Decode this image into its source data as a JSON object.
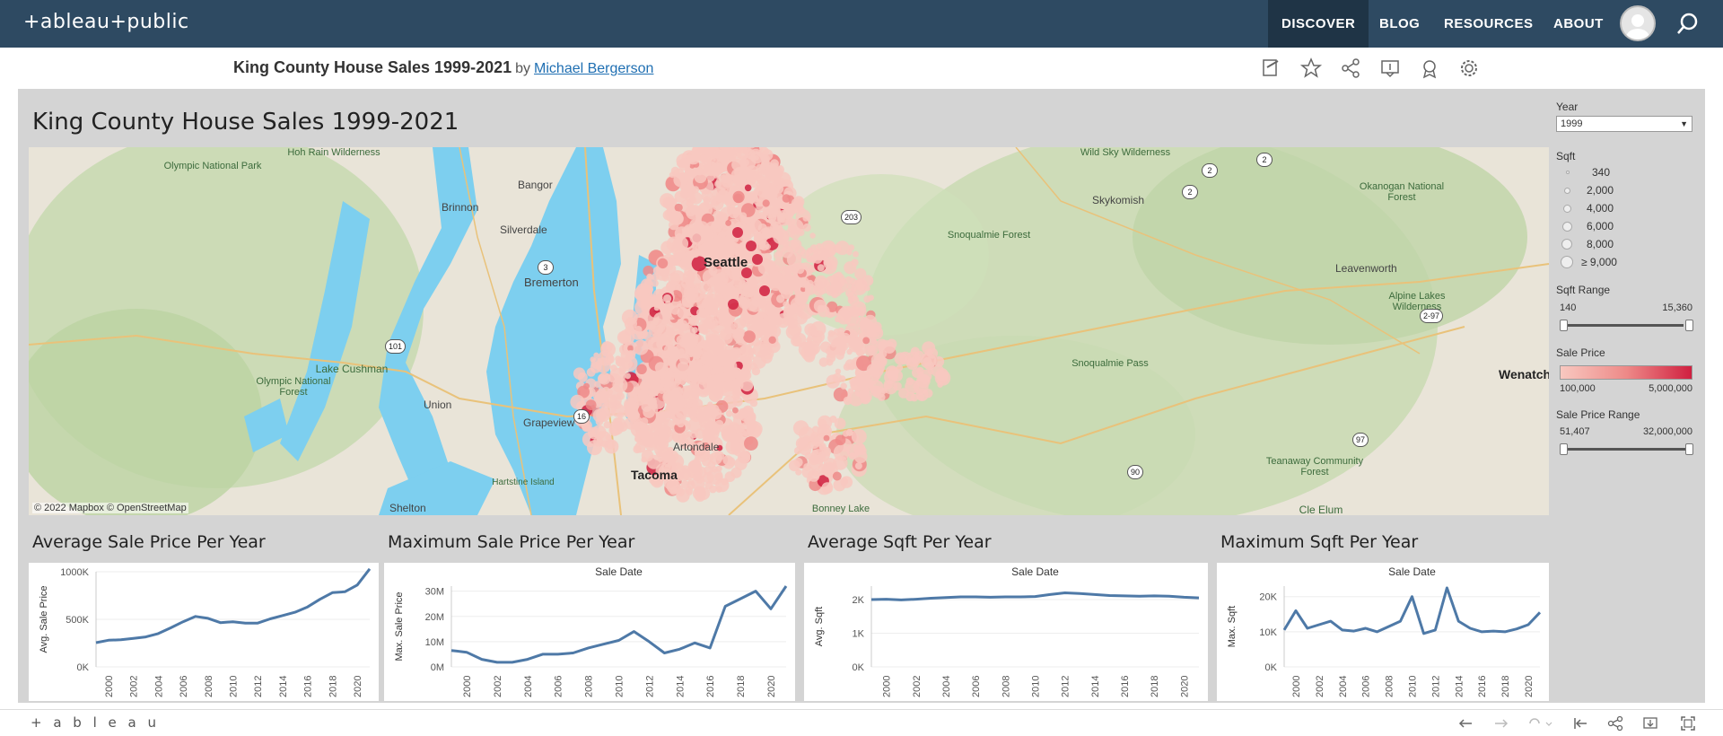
{
  "brand": {
    "logo_text": "+ableau+public",
    "accent": "#2e4a62"
  },
  "nav": {
    "items": [
      "DISCOVER",
      "BLOG",
      "RESOURCES",
      "ABOUT"
    ],
    "active": "DISCOVER"
  },
  "viz_header": {
    "title": "King County House Sales 1999-2021",
    "by": "by",
    "author": "Michael Bergerson"
  },
  "toolbar_icons": [
    "edit-icon",
    "star-icon",
    "share-icon",
    "comment-icon",
    "badge-icon",
    "gear-icon"
  ],
  "dashboard": {
    "title": "King County House Sales 1999-2021",
    "map": {
      "credit": "© 2022 Mapbox  © OpenStreetMap",
      "places": [
        "Olympic National Park",
        "Hoh Rain Wilderness",
        "Brinnon",
        "Bangor",
        "Silverdale",
        "Seattle",
        "Bremerton",
        "Lake Cushman",
        "Olympic National Forest",
        "Union",
        "Grapeview",
        "Artondale",
        "Tacoma",
        "Hartstine Island",
        "Shelton",
        "Bonney Lake",
        "Wild Sky Wilderness",
        "Skykomish",
        "Snoqualmie Forest",
        "Alpine Lakes Wilderness",
        "Snoqualmie Pass",
        "Leavenworth",
        "Okanogan National Forest",
        "Wenatchee",
        "Teanaway Community Forest",
        "Cle Elum"
      ],
      "shields": [
        "3",
        "101",
        "16",
        "2",
        "2",
        "2",
        "203",
        "90",
        "2-97",
        "97"
      ]
    },
    "filters": {
      "year_label": "Year",
      "year_value": "1999",
      "sqft_label": "Sqft",
      "sqft_legend": [
        "340",
        "2,000",
        "4,000",
        "6,000",
        "8,000",
        "≥ 9,000"
      ],
      "sqft_range_label": "Sqft Range",
      "sqft_range": [
        "140",
        "15,360"
      ],
      "price_label": "Sale Price",
      "price_legend": [
        "100,000",
        "5,000,000"
      ],
      "price_range_label": "Sale Price Range",
      "price_range": [
        "51,407",
        "32,000,000"
      ],
      "price_colors": [
        "#f8c8c0",
        "#ee8a88",
        "#d02040"
      ]
    }
  },
  "panels": [
    {
      "title": "Average Sale Price Per Year",
      "header": "",
      "ylabel": "Avg. Sale Price"
    },
    {
      "title": "Maximum Sale Price Per Year",
      "header": "Sale Date",
      "ylabel": "Max. Sale Price"
    },
    {
      "title": "Average Sqft Per Year",
      "header": "Sale Date",
      "ylabel": "Avg. Sqft"
    },
    {
      "title": "Maximum Sqft Per Year",
      "header": "Sale Date",
      "ylabel": "Max. Sqft"
    }
  ],
  "footer": {
    "logo_text": "+ a b l e a u"
  },
  "chart_data": [
    {
      "type": "line",
      "title": "Average Sale Price Per Year",
      "xlabel": "",
      "ylabel": "Avg. Sale Price",
      "x": [
        1999,
        2000,
        2001,
        2002,
        2003,
        2004,
        2005,
        2006,
        2007,
        2008,
        2009,
        2010,
        2011,
        2012,
        2013,
        2014,
        2015,
        2016,
        2017,
        2018,
        2019,
        2020,
        2021
      ],
      "xticks": [
        "2000",
        "2002",
        "2004",
        "2006",
        "2008",
        "2010",
        "2012",
        "2014",
        "2016",
        "2018",
        "2020"
      ],
      "yticks": [
        "0K",
        "500K",
        "1000K"
      ],
      "yticks_values": [
        0,
        500000,
        1000000
      ],
      "ylim": [
        0,
        1000000
      ],
      "series": [
        {
          "values": [
            255000,
            280000,
            285000,
            300000,
            315000,
            350000,
            410000,
            475000,
            530000,
            510000,
            465000,
            475000,
            460000,
            460000,
            505000,
            540000,
            575000,
            630000,
            710000,
            780000,
            790000,
            860000,
            1030000
          ]
        }
      ],
      "color": "#4e79a7"
    },
    {
      "type": "line",
      "title": "Maximum Sale Price Per Year",
      "xlabel": "Sale Date",
      "ylabel": "Max. Sale Price",
      "x": [
        1999,
        2000,
        2001,
        2002,
        2003,
        2004,
        2005,
        2006,
        2007,
        2008,
        2009,
        2010,
        2011,
        2012,
        2013,
        2014,
        2015,
        2016,
        2017,
        2018,
        2019,
        2020,
        2021
      ],
      "xticks": [
        "2000",
        "2002",
        "2004",
        "2006",
        "2008",
        "2010",
        "2012",
        "2014",
        "2016",
        "2018",
        "2020"
      ],
      "yticks": [
        "0M",
        "10M",
        "20M",
        "30M"
      ],
      "yticks_values": [
        0,
        10000000,
        20000000,
        30000000
      ],
      "ylim": [
        0,
        32000000
      ],
      "series": [
        {
          "values": [
            6500000,
            5800000,
            3000000,
            1800000,
            1800000,
            3000000,
            5000000,
            5000000,
            5500000,
            7500000,
            9000000,
            10500000,
            14000000,
            10000000,
            5500000,
            7000000,
            9500000,
            7500000,
            24000000,
            27000000,
            30000000,
            23000000,
            32000000
          ]
        }
      ],
      "color": "#4e79a7"
    },
    {
      "type": "line",
      "title": "Average Sqft Per Year",
      "xlabel": "Sale Date",
      "ylabel": "Avg. Sqft",
      "x": [
        1999,
        2000,
        2001,
        2002,
        2003,
        2004,
        2005,
        2006,
        2007,
        2008,
        2009,
        2010,
        2011,
        2012,
        2013,
        2014,
        2015,
        2016,
        2017,
        2018,
        2019,
        2020,
        2021
      ],
      "xticks": [
        "2000",
        "2002",
        "2004",
        "2006",
        "2008",
        "2010",
        "2012",
        "2014",
        "2016",
        "2018",
        "2020"
      ],
      "yticks": [
        "0K",
        "1K",
        "2K"
      ],
      "yticks_values": [
        0,
        1000,
        2000
      ],
      "ylim": [
        0,
        2400
      ],
      "series": [
        {
          "values": [
            2000,
            2010,
            1990,
            2010,
            2040,
            2060,
            2080,
            2080,
            2070,
            2080,
            2080,
            2090,
            2150,
            2200,
            2180,
            2150,
            2120,
            2110,
            2100,
            2110,
            2100,
            2070,
            2050
          ]
        }
      ],
      "color": "#4e79a7"
    },
    {
      "type": "line",
      "title": "Maximum Sqft Per Year",
      "xlabel": "Sale Date",
      "ylabel": "Max. Sqft",
      "x": [
        1999,
        2000,
        2001,
        2002,
        2003,
        2004,
        2005,
        2006,
        2007,
        2008,
        2009,
        2010,
        2011,
        2012,
        2013,
        2014,
        2015,
        2016,
        2017,
        2018,
        2019,
        2020,
        2021
      ],
      "xticks": [
        "2000",
        "2002",
        "2004",
        "2006",
        "2008",
        "2010",
        "2012",
        "2014",
        "2016",
        "2018",
        "2020"
      ],
      "yticks": [
        "0K",
        "10K",
        "20K"
      ],
      "yticks_values": [
        0,
        10000,
        20000
      ],
      "ylim": [
        0,
        23000
      ],
      "series": [
        {
          "values": [
            10500,
            16000,
            11000,
            12000,
            13000,
            10500,
            10200,
            11000,
            10000,
            11500,
            13000,
            20000,
            9500,
            10500,
            22500,
            13000,
            11000,
            10000,
            10200,
            10000,
            10800,
            12000,
            15500
          ]
        }
      ],
      "color": "#4e79a7"
    }
  ]
}
